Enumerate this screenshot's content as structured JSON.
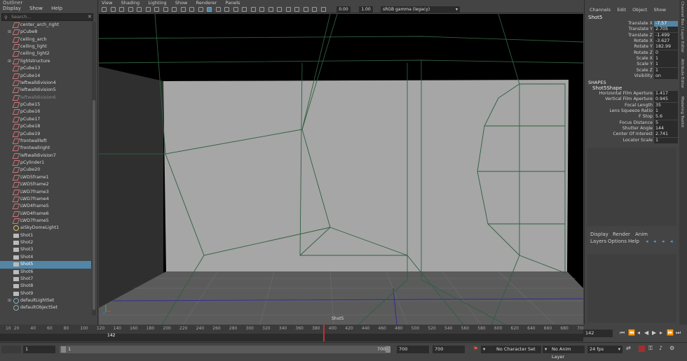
{
  "outliner": {
    "title": "Outliner",
    "menu": [
      "Display",
      "Show",
      "Help"
    ],
    "search_placeholder": "Search...",
    "items": [
      {
        "label": "center_arch_right",
        "type": "mesh"
      },
      {
        "label": "pCube8",
        "type": "mesh",
        "expandable": true
      },
      {
        "label": "ceiling_arch",
        "type": "mesh"
      },
      {
        "label": "ceiling_light",
        "type": "mesh"
      },
      {
        "label": "ceiling_light2",
        "type": "mesh"
      },
      {
        "label": "lightstructure",
        "type": "mesh",
        "expandable": true
      },
      {
        "label": "pCube13",
        "type": "mesh"
      },
      {
        "label": "pCube14",
        "type": "mesh"
      },
      {
        "label": "leftwalldivision4",
        "type": "mesh"
      },
      {
        "label": "leftwalldivision5",
        "type": "mesh"
      },
      {
        "label": "leftwalldivision6",
        "type": "mesh",
        "dim": true
      },
      {
        "label": "pCube15",
        "type": "mesh"
      },
      {
        "label": "pCube16",
        "type": "mesh"
      },
      {
        "label": "pCube17",
        "type": "mesh"
      },
      {
        "label": "pCube18",
        "type": "mesh"
      },
      {
        "label": "pCube19",
        "type": "mesh"
      },
      {
        "label": "frontwallleft",
        "type": "mesh"
      },
      {
        "label": "frontwallright",
        "type": "mesh"
      },
      {
        "label": "leftwalldivision7",
        "type": "mesh"
      },
      {
        "label": "pCylinder1",
        "type": "mesh"
      },
      {
        "label": "pCube20",
        "type": "mesh"
      },
      {
        "label": "LWD5frame1",
        "type": "mesh"
      },
      {
        "label": "LWD5frame2",
        "type": "mesh"
      },
      {
        "label": "LWD7frame3",
        "type": "mesh"
      },
      {
        "label": "LWD7frame4",
        "type": "mesh"
      },
      {
        "label": "LWD4frame5",
        "type": "mesh"
      },
      {
        "label": "LWD4frame6",
        "type": "mesh"
      },
      {
        "label": "LWD7frame5",
        "type": "mesh"
      },
      {
        "label": "aiSkyDomeLight1",
        "type": "light"
      },
      {
        "label": "Shot1",
        "type": "camera"
      },
      {
        "label": "Shot2",
        "type": "camera"
      },
      {
        "label": "Shot3",
        "type": "camera"
      },
      {
        "label": "Shot4",
        "type": "camera"
      },
      {
        "label": "Shot5",
        "type": "camera",
        "selected": true
      },
      {
        "label": "Shot6",
        "type": "camera"
      },
      {
        "label": "Shot7",
        "type": "camera"
      },
      {
        "label": "Shot8",
        "type": "camera"
      },
      {
        "label": "Shot9",
        "type": "camera"
      },
      {
        "label": "defaultLightSet",
        "type": "set",
        "expandable": true
      },
      {
        "label": "defaultObjectSet",
        "type": "set"
      }
    ]
  },
  "viewport": {
    "menu": [
      "View",
      "Shading",
      "Lighting",
      "Show",
      "Renderer",
      "Panels"
    ],
    "field_a": "0.00",
    "field_b": "1.00",
    "colorspace": "sRGB gamma (legacy)",
    "camera_label": "Shot5"
  },
  "channel_box": {
    "menu": [
      "Channels",
      "Edit",
      "Object",
      "Show"
    ],
    "object_name": "Shot5",
    "channels": [
      {
        "name": "Translate X",
        "value": "-7.57",
        "highlight": true
      },
      {
        "name": "Translate Y",
        "value": "2.705"
      },
      {
        "name": "Translate Z",
        "value": "-1.499"
      },
      {
        "name": "Rotate X",
        "value": "-3.627"
      },
      {
        "name": "Rotate Y",
        "value": "182.99"
      },
      {
        "name": "Rotate Z",
        "value": "0"
      },
      {
        "name": "Scale X",
        "value": "1"
      },
      {
        "name": "Scale Y",
        "value": "1"
      },
      {
        "name": "Scale Z",
        "value": "1"
      },
      {
        "name": "Visibility",
        "value": "on"
      }
    ],
    "shapes_label": "SHAPES",
    "shape_name": "Shot5Shape",
    "shape_channels": [
      {
        "name": "Horizontal Film Aperture",
        "value": "1.417"
      },
      {
        "name": "Vertical Film Aperture",
        "value": "0.945"
      },
      {
        "name": "Focal Length",
        "value": "35"
      },
      {
        "name": "Lens Squeeze Ratio",
        "value": "1"
      },
      {
        "name": "F Stop",
        "value": "5.6"
      },
      {
        "name": "Focus Distance",
        "value": "5"
      },
      {
        "name": "Shutter Angle",
        "value": "144"
      },
      {
        "name": "Center Of Interest",
        "value": "2.741"
      },
      {
        "name": "Locator Scale",
        "value": "1"
      }
    ]
  },
  "layer_editor": {
    "tabs": [
      "Display",
      "Render",
      "Anim"
    ],
    "menu": [
      "Layers",
      "Options",
      "Help"
    ]
  },
  "side_tabs": [
    "Channel Box / Layer Editor",
    "Attribute Editor",
    "Modeling Toolkit"
  ],
  "timeline": {
    "ticks": [
      "10",
      "20",
      "40",
      "60",
      "80",
      "100",
      "120",
      "140",
      "160",
      "180",
      "200",
      "220",
      "240",
      "260",
      "280",
      "300",
      "320",
      "340",
      "360",
      "380",
      "400",
      "420",
      "440",
      "460",
      "480",
      "500",
      "520",
      "540",
      "560",
      "580",
      "600",
      "620",
      "640",
      "660",
      "680",
      "700"
    ],
    "current_frame_marker": "142",
    "current_frame_field": "142"
  },
  "range": {
    "start": "1",
    "start_inner": "1",
    "end_inner": "700",
    "end": "700",
    "end2": "700",
    "character_set": "No Character Set",
    "anim_layer": "No Anim Layer",
    "fps": "24 fps"
  }
}
